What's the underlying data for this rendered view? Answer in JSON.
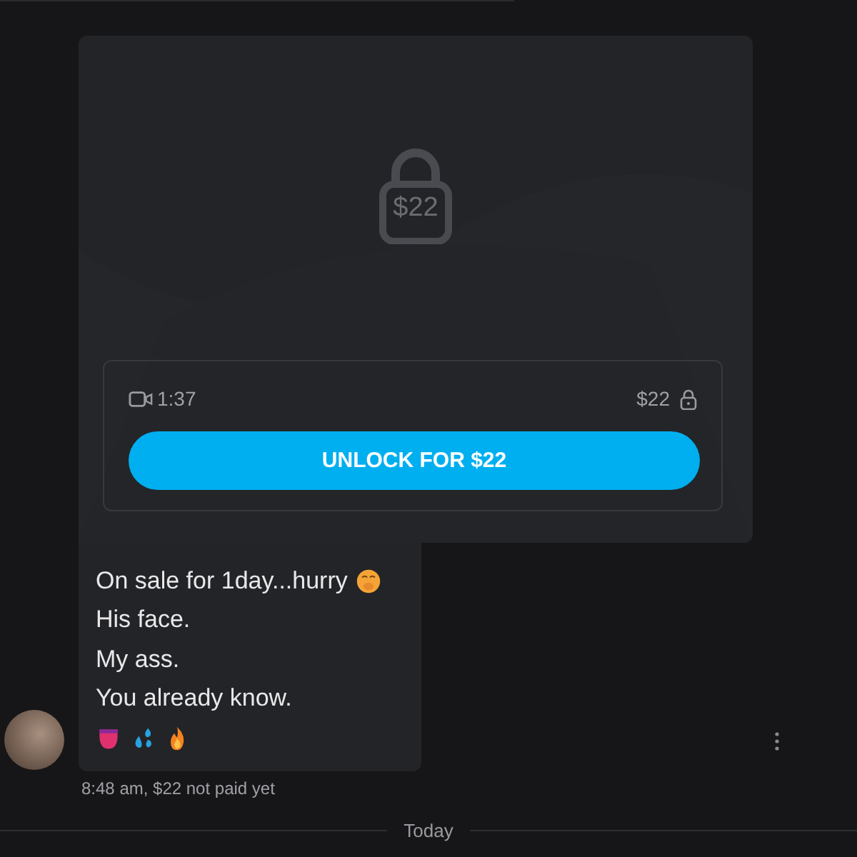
{
  "media": {
    "locked_price": "$22",
    "duration": "1:37",
    "price": "$22",
    "unlock_button": "UNLOCK FOR $22"
  },
  "message": {
    "lines": [
      "On sale for 1day...hurry",
      "His face.",
      "My ass.",
      "You already know."
    ],
    "meta": "8:48 am, $22 not paid yet"
  },
  "divider": "Today"
}
